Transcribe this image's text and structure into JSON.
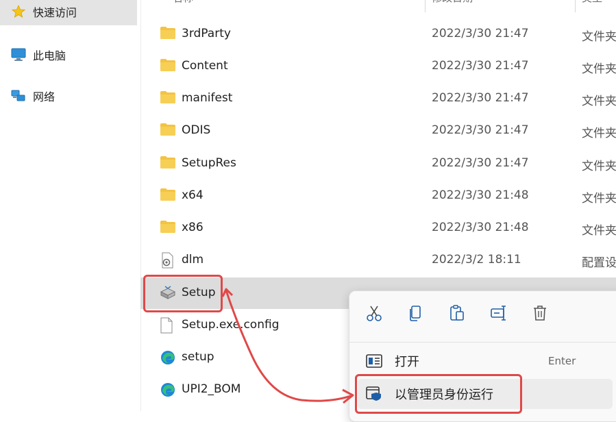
{
  "sidebar": {
    "items": [
      {
        "label": "快速访问",
        "icon": "star-icon",
        "active": true
      },
      {
        "label": "此电脑",
        "icon": "monitor-icon",
        "active": false
      },
      {
        "label": "网络",
        "icon": "network-icon",
        "active": false
      }
    ]
  },
  "headers": {
    "name": "名称",
    "date": "修改日期",
    "type": "类型"
  },
  "files": [
    {
      "name": "3rdParty",
      "date": "2022/3/30 21:47",
      "type": "文件夹",
      "icon": "folder-icon"
    },
    {
      "name": "Content",
      "date": "2022/3/30 21:47",
      "type": "文件夹",
      "icon": "folder-icon"
    },
    {
      "name": "manifest",
      "date": "2022/3/30 21:47",
      "type": "文件夹",
      "icon": "folder-icon"
    },
    {
      "name": "ODIS",
      "date": "2022/3/30 21:47",
      "type": "文件夹",
      "icon": "folder-icon"
    },
    {
      "name": "SetupRes",
      "date": "2022/3/30 21:47",
      "type": "文件夹",
      "icon": "folder-icon"
    },
    {
      "name": "x64",
      "date": "2022/3/30 21:48",
      "type": "文件夹",
      "icon": "folder-icon"
    },
    {
      "name": "x86",
      "date": "2022/3/30 21:48",
      "type": "文件夹",
      "icon": "folder-icon"
    },
    {
      "name": "dlm",
      "date": "2022/3/2 18:11",
      "type": "配置设",
      "icon": "config-file-icon"
    },
    {
      "name": "Setup",
      "date": "",
      "type": "",
      "icon": "setup-exe-icon",
      "selected": true
    },
    {
      "name": "Setup.exe.config",
      "date": "",
      "type": "",
      "icon": "document-icon"
    },
    {
      "name": "setup",
      "date": "",
      "type": "",
      "icon": "edge-icon"
    },
    {
      "name": "UPI2_BOM",
      "date": "",
      "type": "",
      "icon": "edge-icon"
    }
  ],
  "context_menu": {
    "quick_actions": [
      {
        "name": "cut",
        "icon": "scissors-icon"
      },
      {
        "name": "copy",
        "icon": "copy-icon"
      },
      {
        "name": "paste",
        "icon": "paste-icon"
      },
      {
        "name": "rename",
        "icon": "rename-icon"
      },
      {
        "name": "delete",
        "icon": "trash-icon"
      }
    ],
    "items": [
      {
        "label": "打开",
        "shortcut": "Enter",
        "icon": "open-icon"
      },
      {
        "label": "以管理员身份运行",
        "shortcut": "",
        "icon": "admin-shield-icon"
      }
    ]
  },
  "colors": {
    "folder": "#f3c343",
    "annotation": "#e04848",
    "selected_row": "#dcdcdc"
  }
}
